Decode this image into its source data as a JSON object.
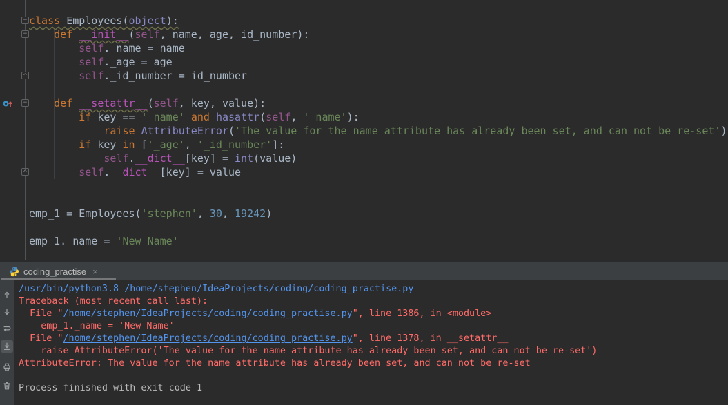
{
  "colors": {
    "editor_bg": "#2b2b2b",
    "panel_bg": "#3c3f41",
    "keyword": "#cc7832",
    "string": "#6a8759",
    "number": "#6897bb",
    "self": "#94558d",
    "magic_method": "#b753b7",
    "builtin": "#8888c6",
    "default_text": "#a9b7c6",
    "error_red": "#ff6b68",
    "link_blue": "#5394ec",
    "tab_underline": "#757779"
  },
  "editor": {
    "lines": [
      {
        "tokens": [
          {
            "t": "class",
            "c": "kw",
            "u": true
          },
          {
            "t": " ",
            "c": "txt",
            "u": true
          },
          {
            "t": "Employees(",
            "c": "txt",
            "u": true
          },
          {
            "t": "object",
            "c": "builtin",
            "u": true
          },
          {
            "t": "):",
            "c": "txt",
            "u": true
          }
        ]
      },
      {
        "tokens": [
          {
            "t": "    ",
            "c": "txt"
          },
          {
            "t": "def",
            "c": "kw"
          },
          {
            "t": " ",
            "c": "txt"
          },
          {
            "t": "__init__",
            "c": "fn",
            "u": true
          },
          {
            "t": "(",
            "c": "txt"
          },
          {
            "t": "self",
            "c": "self"
          },
          {
            "t": ", name, age, id_number):",
            "c": "txt"
          }
        ]
      },
      {
        "tokens": [
          {
            "t": "        ",
            "c": "txt"
          },
          {
            "t": "self",
            "c": "self"
          },
          {
            "t": "._name = name",
            "c": "txt"
          }
        ]
      },
      {
        "tokens": [
          {
            "t": "        ",
            "c": "txt"
          },
          {
            "t": "self",
            "c": "self"
          },
          {
            "t": "._age = age",
            "c": "txt"
          }
        ]
      },
      {
        "tokens": [
          {
            "t": "        ",
            "c": "txt"
          },
          {
            "t": "self",
            "c": "self"
          },
          {
            "t": "._id_number = id_number",
            "c": "txt"
          }
        ]
      },
      {
        "tokens": []
      },
      {
        "tokens": [
          {
            "t": "    ",
            "c": "txt"
          },
          {
            "t": "def",
            "c": "kw"
          },
          {
            "t": " ",
            "c": "txt"
          },
          {
            "t": "__setattr__",
            "c": "fn",
            "u": true
          },
          {
            "t": "(",
            "c": "txt"
          },
          {
            "t": "self",
            "c": "self"
          },
          {
            "t": ", key, value):",
            "c": "txt"
          }
        ]
      },
      {
        "tokens": [
          {
            "t": "        ",
            "c": "txt"
          },
          {
            "t": "if",
            "c": "kw"
          },
          {
            "t": " key == ",
            "c": "txt"
          },
          {
            "t": "'_name'",
            "c": "str"
          },
          {
            "t": " ",
            "c": "txt"
          },
          {
            "t": "and",
            "c": "kw"
          },
          {
            "t": " ",
            "c": "txt"
          },
          {
            "t": "hasattr",
            "c": "builtin"
          },
          {
            "t": "(",
            "c": "txt"
          },
          {
            "t": "self",
            "c": "self"
          },
          {
            "t": ", ",
            "c": "txt"
          },
          {
            "t": "'_name'",
            "c": "str"
          },
          {
            "t": "):",
            "c": "txt"
          }
        ]
      },
      {
        "tokens": [
          {
            "t": "            ",
            "c": "txt"
          },
          {
            "t": "raise",
            "c": "kw"
          },
          {
            "t": " ",
            "c": "txt"
          },
          {
            "t": "AttributeError",
            "c": "builtin"
          },
          {
            "t": "(",
            "c": "txt"
          },
          {
            "t": "'The value for the name attribute has already been set, and can not be re-set'",
            "c": "str"
          },
          {
            "t": ")",
            "c": "txt"
          }
        ]
      },
      {
        "tokens": [
          {
            "t": "        ",
            "c": "txt"
          },
          {
            "t": "if",
            "c": "kw"
          },
          {
            "t": " key ",
            "c": "txt"
          },
          {
            "t": "in",
            "c": "kw"
          },
          {
            "t": " [",
            "c": "txt"
          },
          {
            "t": "'_age'",
            "c": "str"
          },
          {
            "t": ", ",
            "c": "txt"
          },
          {
            "t": "'_id_number'",
            "c": "str"
          },
          {
            "t": "]:",
            "c": "txt"
          }
        ]
      },
      {
        "tokens": [
          {
            "t": "            ",
            "c": "txt"
          },
          {
            "t": "self",
            "c": "self"
          },
          {
            "t": ".",
            "c": "txt"
          },
          {
            "t": "__dict__",
            "c": "fn"
          },
          {
            "t": "[key] = ",
            "c": "txt"
          },
          {
            "t": "int",
            "c": "builtin"
          },
          {
            "t": "(value)",
            "c": "txt"
          }
        ]
      },
      {
        "tokens": [
          {
            "t": "        ",
            "c": "txt"
          },
          {
            "t": "self",
            "c": "self"
          },
          {
            "t": ".",
            "c": "txt"
          },
          {
            "t": "__dict__",
            "c": "fn"
          },
          {
            "t": "[key] = value",
            "c": "txt"
          }
        ]
      },
      {
        "tokens": []
      },
      {
        "tokens": []
      },
      {
        "tokens": [
          {
            "t": "emp_1 = Employees(",
            "c": "txt"
          },
          {
            "t": "'stephen'",
            "c": "str"
          },
          {
            "t": ", ",
            "c": "txt"
          },
          {
            "t": "30",
            "c": "num"
          },
          {
            "t": ", ",
            "c": "txt"
          },
          {
            "t": "19242",
            "c": "num"
          },
          {
            "t": ")",
            "c": "txt"
          }
        ]
      },
      {
        "tokens": []
      },
      {
        "tokens": [
          {
            "t": "emp_1._name = ",
            "c": "txt"
          },
          {
            "t": "'New Name'",
            "c": "str"
          }
        ]
      }
    ],
    "gutter": {
      "markers": [
        {
          "line": 1,
          "type": "start"
        },
        {
          "line": 2,
          "type": "start"
        },
        {
          "line": 5,
          "type": "end"
        },
        {
          "line": 7,
          "type": "start"
        },
        {
          "line": 12,
          "type": "end"
        }
      ],
      "override_icon_line": 7
    }
  },
  "run_panel": {
    "tab": {
      "label": "coding_practise",
      "close_glyph": "×",
      "icon": "python-logo-icon"
    },
    "toolbar_icons": [
      {
        "name": "up-the-stack-trace-icon"
      },
      {
        "name": "down-the-stack-trace-icon"
      },
      {
        "name": "soft-wrap-icon"
      },
      {
        "name": "scroll-to-end-icon",
        "selected": true
      },
      {
        "name": "print-icon"
      },
      {
        "name": "clear-all-icon"
      }
    ],
    "console": {
      "lines": [
        {
          "tokens": [
            {
              "t": "/usr/bin/python3.8",
              "c": "link"
            },
            {
              "t": " ",
              "c": "out"
            },
            {
              "t": "/home/stephen/IdeaProjects/coding/coding_practise.py",
              "c": "link"
            }
          ]
        },
        {
          "tokens": [
            {
              "t": "Traceback (most recent call last):",
              "c": "err"
            }
          ]
        },
        {
          "tokens": [
            {
              "t": "  File \"",
              "c": "err"
            },
            {
              "t": "/home/stephen/IdeaProjects/coding/coding_practise.py",
              "c": "link"
            },
            {
              "t": "\", line 1386, in <module>",
              "c": "err"
            }
          ]
        },
        {
          "tokens": [
            {
              "t": "    emp_1._name = 'New Name'",
              "c": "err"
            }
          ]
        },
        {
          "tokens": [
            {
              "t": "  File \"",
              "c": "err"
            },
            {
              "t": "/home/stephen/IdeaProjects/coding/coding_practise.py",
              "c": "link"
            },
            {
              "t": "\", line 1378, in __setattr__",
              "c": "err"
            }
          ]
        },
        {
          "tokens": [
            {
              "t": "    raise AttributeError('The value for the name attribute has already been set, and can not be re-set')",
              "c": "err"
            }
          ]
        },
        {
          "tokens": [
            {
              "t": "AttributeError: The value for the name attribute has already been set, and can not be re-set",
              "c": "err"
            }
          ]
        },
        {
          "tokens": []
        },
        {
          "tokens": [
            {
              "t": "Process finished with exit code 1",
              "c": "out"
            }
          ]
        }
      ]
    }
  }
}
